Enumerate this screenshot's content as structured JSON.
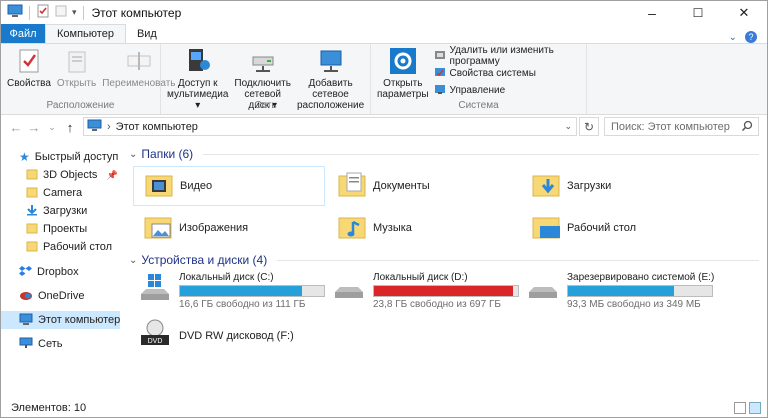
{
  "window": {
    "title": "Этот компьютер",
    "minimize": "–",
    "maximize": "☐",
    "close": "✕"
  },
  "tabs": {
    "file": "Файл",
    "computer": "Компьютер",
    "view": "Вид"
  },
  "ribbon": {
    "location_group": {
      "label": "Расположение",
      "properties": "Свойства",
      "open": "Открыть",
      "rename": "Переименовать"
    },
    "network_group": {
      "label": "Сеть",
      "media": [
        "Доступ к",
        "мультимедиа ▾"
      ],
      "map_drive": [
        "Подключить",
        "сетевой диск ▾"
      ],
      "add_location": [
        "Добавить сетевое",
        "расположение"
      ]
    },
    "system_group": {
      "label": "Система",
      "open_settings": [
        "Открыть",
        "параметры"
      ],
      "uninstall": "Удалить или изменить программу",
      "system_props": "Свойства системы",
      "manage": "Управление"
    }
  },
  "address": {
    "path": "Этот компьютер",
    "search_placeholder": "Поиск: Этот компьютер"
  },
  "nav": {
    "quick_access": "Быстрый доступ",
    "items": [
      "3D Objects",
      "Camera",
      "Загрузки",
      "Проекты",
      "Рабочий стол"
    ],
    "dropbox": "Dropbox",
    "onedrive": "OneDrive",
    "this_pc": "Этот компьютер",
    "network": "Сеть"
  },
  "folders_header": "Папки (6)",
  "folders": [
    "Видео",
    "Документы",
    "Загрузки",
    "Изображения",
    "Музыка",
    "Рабочий стол"
  ],
  "devices_header": "Устройства и диски (4)",
  "drives": [
    {
      "name": "Локальный диск (C:)",
      "free": "16,6 ГБ свободно из 111 ГБ",
      "used_fraction": 0.85,
      "color": "#26a0da"
    },
    {
      "name": "Локальный диск (D:)",
      "free": "23,8 ГБ свободно из 697 ГБ",
      "used_fraction": 0.966,
      "color": "#da2626"
    },
    {
      "name": "Зарезервировано системой (E:)",
      "free": "93,3 МБ свободно из 349 МБ",
      "used_fraction": 0.733,
      "color": "#26a0da"
    }
  ],
  "dvd": {
    "name": "DVD RW дисковод (F:)",
    "badge": "DVD"
  },
  "status": {
    "items": "Элементов: 10"
  }
}
